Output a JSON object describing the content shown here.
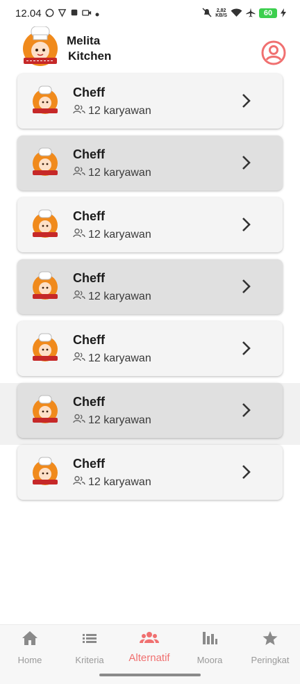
{
  "status_bar": {
    "time": "12.04",
    "net_speed_value": "2,82",
    "net_speed_unit": "KB/S",
    "battery": "60",
    "icons": [
      "whatsapp-icon",
      "vpn-icon",
      "sim-icon",
      "video-icon",
      "dot-icon",
      "mute-icon",
      "wifi-icon",
      "airplane-icon",
      "charging-icon"
    ]
  },
  "header": {
    "brand_line1": "Melita",
    "brand_line2": "Kitchen",
    "logo_icon": "chef-logo",
    "profile_icon": "account-circle-icon",
    "accent_color": "#f07070"
  },
  "alternatives": [
    {
      "title": "Cheff",
      "employees": "12 karyawan"
    },
    {
      "title": "Cheff",
      "employees": "12 karyawan"
    },
    {
      "title": "Cheff",
      "employees": "12 karyawan"
    },
    {
      "title": "Cheff",
      "employees": "12 karyawan"
    },
    {
      "title": "Cheff",
      "employees": "12 karyawan"
    },
    {
      "title": "Cheff",
      "employees": "12 karyawan"
    },
    {
      "title": "Cheff",
      "employees": "12 karyawan"
    }
  ],
  "bottom_nav": {
    "items": [
      {
        "label": "Home",
        "icon": "home-icon"
      },
      {
        "label": "Kriteria",
        "icon": "list-icon"
      },
      {
        "label": "Alternatif",
        "icon": "group-icon"
      },
      {
        "label": "Moora",
        "icon": "bar-chart-icon"
      },
      {
        "label": "Peringkat",
        "icon": "star-icon"
      }
    ],
    "active": "Alternatif",
    "active_color": "#f07070",
    "inactive_color": "#9a9a9a"
  }
}
